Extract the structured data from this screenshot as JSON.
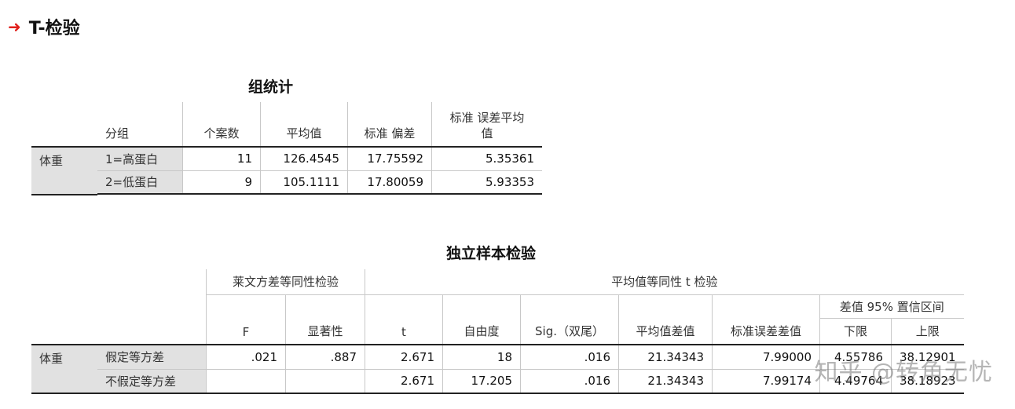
{
  "heading": {
    "title": "T-检验",
    "arrow_icon": "red-right-arrow"
  },
  "group_stats": {
    "caption": "组统计",
    "headers": [
      "分组",
      "个案数",
      "平均值",
      "标准 偏差",
      "标准 误差平均值"
    ],
    "header_last_line1": "标准 误差平均",
    "header_last_line2": "值",
    "variable": "体重",
    "rows": [
      {
        "group": "1=高蛋白",
        "n": "11",
        "mean": "126.4545",
        "sd": "17.75592",
        "se": "5.35361"
      },
      {
        "group": "2=低蛋白",
        "n": "9",
        "mean": "105.1111",
        "sd": "17.80059",
        "se": "5.93353"
      }
    ]
  },
  "indep_test": {
    "caption": "独立样本检验",
    "levene_header": "莱文方差等同性检验",
    "ttest_header": "平均值等同性 t 检验",
    "ci_header": "差值 95% 置信区间",
    "columns": [
      "F",
      "显著性",
      "t",
      "自由度",
      "Sig.（双尾）",
      "平均值差值",
      "标准误差差值",
      "下限",
      "上限"
    ],
    "variable": "体重",
    "rows": [
      {
        "label": "假定等方差",
        "F": ".021",
        "sig": ".887",
        "t": "2.671",
        "df": "18",
        "sig2": ".016",
        "md": "21.34343",
        "sed": "7.99000",
        "lower": "4.55786",
        "upper": "38.12901"
      },
      {
        "label": "不假定等方差",
        "F": "",
        "sig": "",
        "t": "2.671",
        "df": "17.205",
        "sig2": ".016",
        "md": "21.34343",
        "sed": "7.99174",
        "lower": "4.49764",
        "upper": "38.18923"
      }
    ]
  },
  "watermark": "知乎 @转角无忧"
}
